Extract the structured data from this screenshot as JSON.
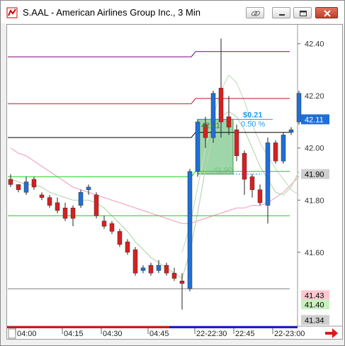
{
  "window": {
    "title": "S.AAL - American Airlines Group Inc., 3 Min"
  },
  "colors": {
    "up": "#1f6fd6",
    "down": "#d81f1f",
    "accent_label": "#1f9bf0",
    "green_line": "#14d414",
    "purple_line": "#800080",
    "red_line": "#c0142a"
  },
  "chart_data": {
    "type": "candlestick",
    "ylim": [
      41.33,
      42.47
    ],
    "y_ticks": [
      "42.40",
      "42.20",
      "42.00",
      "41.80",
      "41.60"
    ],
    "x_ticks": [
      "04:00",
      "04:15",
      "04:30",
      "04:45",
      "22-22:30",
      "22:45",
      "22-23:00"
    ],
    "price_labels": [
      {
        "text": "42.11",
        "value": 42.11,
        "bg": "#1f6fd6",
        "fg": "#ffffff"
      },
      {
        "text": "41.90",
        "value": 41.9,
        "bg": "#cfcfcf",
        "fg": "#000000"
      },
      {
        "text": "41.43",
        "value": 41.435,
        "bg": "#ffc8d0",
        "fg": "#000000"
      },
      {
        "text": "41.40",
        "value": 41.4,
        "bg": "#c8f0c0",
        "fg": "#000000"
      },
      {
        "text": "41.34",
        "value": 41.34,
        "bg": "#cfcfcf",
        "fg": "#000000"
      }
    ],
    "candles": [
      {
        "o": 41.88,
        "h": 41.9,
        "l": 41.85,
        "c": 41.86
      },
      {
        "o": 41.86,
        "h": 41.86,
        "l": 41.83,
        "c": 41.84
      },
      {
        "o": 41.83,
        "h": 41.89,
        "l": 41.82,
        "c": 41.87
      },
      {
        "o": 41.88,
        "h": 41.89,
        "l": 41.84,
        "c": 41.85
      },
      {
        "o": 41.82,
        "h": 41.83,
        "l": 41.8,
        "c": 41.81
      },
      {
        "o": 41.81,
        "h": 41.82,
        "l": 41.77,
        "c": 41.78
      },
      {
        "o": 41.79,
        "h": 41.81,
        "l": 41.75,
        "c": 41.76
      },
      {
        "o": 41.77,
        "h": 41.79,
        "l": 41.72,
        "c": 41.73
      },
      {
        "o": 41.77,
        "h": 41.78,
        "l": 41.7,
        "c": 41.73
      },
      {
        "o": 41.78,
        "h": 41.84,
        "l": 41.77,
        "c": 41.83
      },
      {
        "o": 41.84,
        "h": 41.86,
        "l": 41.82,
        "c": 41.85
      },
      {
        "o": 41.82,
        "h": 41.83,
        "l": 41.73,
        "c": 41.74
      },
      {
        "o": 41.72,
        "h": 41.74,
        "l": 41.69,
        "c": 41.7
      },
      {
        "o": 41.71,
        "h": 41.72,
        "l": 41.67,
        "c": 41.68
      },
      {
        "o": 41.68,
        "h": 41.69,
        "l": 41.62,
        "c": 41.63
      },
      {
        "o": 41.64,
        "h": 41.65,
        "l": 41.59,
        "c": 41.6
      },
      {
        "o": 41.61,
        "h": 41.62,
        "l": 41.51,
        "c": 41.52
      },
      {
        "o": 41.53,
        "h": 41.55,
        "l": 41.52,
        "c": 41.54
      },
      {
        "o": 41.55,
        "h": 41.56,
        "l": 41.51,
        "c": 41.52
      },
      {
        "o": 41.53,
        "h": 41.57,
        "l": 41.52,
        "c": 41.55
      },
      {
        "o": 41.55,
        "h": 41.56,
        "l": 41.51,
        "c": 41.52
      },
      {
        "o": 41.52,
        "h": 41.54,
        "l": 41.49,
        "c": 41.5
      },
      {
        "o": 41.49,
        "h": 41.52,
        "l": 41.38,
        "c": 41.48
      },
      {
        "o": 41.46,
        "h": 41.92,
        "l": 41.45,
        "c": 41.91
      },
      {
        "o": 41.91,
        "h": 42.11,
        "l": 41.89,
        "c": 42.1
      },
      {
        "o": 42.09,
        "h": 42.12,
        "l": 42.0,
        "c": 42.04
      },
      {
        "o": 42.04,
        "h": 42.22,
        "l": 42.02,
        "c": 42.21
      },
      {
        "o": 42.23,
        "h": 42.42,
        "l": 42.04,
        "c": 42.1
      },
      {
        "o": 42.12,
        "h": 42.2,
        "l": 42.05,
        "c": 42.08
      },
      {
        "o": 42.07,
        "h": 42.09,
        "l": 41.95,
        "c": 41.97
      },
      {
        "o": 41.98,
        "h": 41.99,
        "l": 41.82,
        "c": 41.88
      },
      {
        "o": 41.89,
        "h": 41.9,
        "l": 41.81,
        "c": 41.84
      },
      {
        "o": 41.84,
        "h": 41.86,
        "l": 41.78,
        "c": 41.79
      },
      {
        "o": 41.78,
        "h": 42.04,
        "l": 41.71,
        "c": 42.02
      },
      {
        "o": 42.02,
        "h": 42.03,
        "l": 41.94,
        "c": 41.95
      },
      {
        "o": 41.95,
        "h": 42.06,
        "l": 41.94,
        "c": 42.05
      },
      {
        "o": 42.06,
        "h": 42.08,
        "l": 42.05,
        "c": 42.07
      },
      {
        "o": 42.1,
        "h": 42.22,
        "l": 42.09,
        "c": 42.21
      }
    ],
    "hlines": [
      {
        "value": 42.37,
        "value_left": 42.35,
        "step_index": 24,
        "color": "#800080"
      },
      {
        "value": 42.19,
        "value_left": 42.17,
        "step_index": 24,
        "color": "#c0142a"
      },
      {
        "value": 42.06,
        "value_left": 42.04,
        "step_index": 24,
        "color": "#000000"
      },
      {
        "value": 41.91,
        "value_left": 41.89,
        "step_index": 24,
        "color": "#14d414"
      },
      {
        "value": 41.74,
        "value_left": 41.74,
        "step_index": 24,
        "color": "#14d414"
      },
      {
        "value": 41.46,
        "value_left": 41.46,
        "step_index": 24,
        "color": "#808080"
      }
    ],
    "ma_lines": [
      {
        "color": "#f2a6c4",
        "values": [
          42.0,
          41.98,
          41.97,
          41.95,
          41.93,
          41.91,
          41.89,
          41.87,
          41.85,
          41.84,
          41.83,
          41.82,
          41.81,
          41.8,
          41.79,
          41.78,
          41.77,
          41.76,
          41.75,
          41.74,
          41.73,
          41.72,
          41.71,
          41.71,
          41.72,
          41.73,
          41.74,
          41.75,
          41.76,
          41.77,
          41.77,
          41.78,
          41.78,
          41.79,
          41.81,
          41.83,
          41.86,
          41.89
        ]
      },
      {
        "color": "#b7d8b2",
        "values": [
          41.88,
          41.87,
          41.86,
          41.86,
          41.85,
          41.83,
          41.82,
          41.81,
          41.8,
          41.8,
          41.8,
          41.79,
          41.77,
          41.74,
          41.71,
          41.68,
          41.64,
          41.61,
          41.58,
          41.56,
          41.54,
          41.52,
          41.5,
          41.6,
          41.75,
          41.92,
          42.05,
          42.12,
          42.14,
          42.12,
          42.07,
          42.0,
          41.93,
          41.88,
          41.83,
          41.82,
          41.85,
          41.91
        ]
      },
      {
        "color": "#c7e0c2",
        "values": [
          null,
          null,
          null,
          null,
          null,
          null,
          null,
          null,
          null,
          null,
          null,
          null,
          null,
          null,
          null,
          null,
          null,
          null,
          null,
          null,
          null,
          null,
          41.6,
          41.7,
          41.85,
          42.0,
          42.12,
          42.22,
          42.28,
          42.25,
          42.18,
          42.09,
          42.02,
          41.97,
          41.92,
          41.88,
          41.84,
          41.82
        ]
      }
    ],
    "annotation": {
      "label": "$0.21",
      "pct": "0.50 %",
      "box_top_label": "42.11",
      "box_bottom_label": "41.90",
      "box_top": 42.11,
      "box_bottom": 41.9,
      "from_index": 24,
      "to_index": 28
    }
  }
}
